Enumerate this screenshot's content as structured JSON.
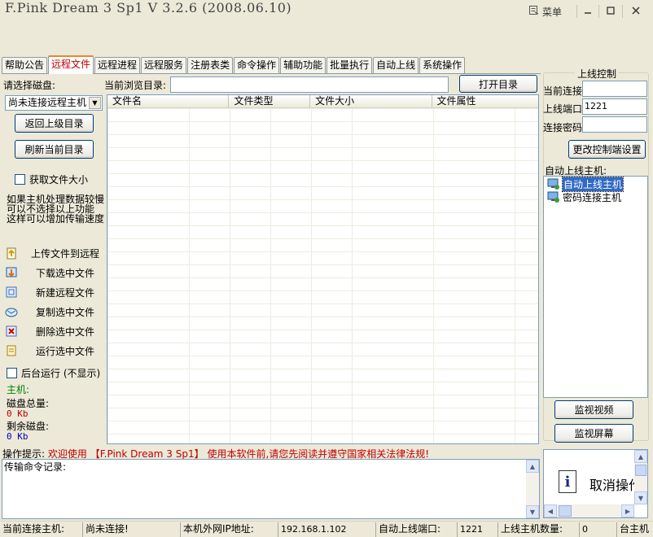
{
  "window": {
    "title": "F.Pink Dream 3 Sp1 V 3.2.6 (2008.06.10)",
    "menu_label": "菜单",
    "menu_icon": "list-icon"
  },
  "tabs": [
    {
      "label": "帮助公告"
    },
    {
      "label": "远程文件",
      "active": true
    },
    {
      "label": "远程进程"
    },
    {
      "label": "远程服务"
    },
    {
      "label": "注册表类"
    },
    {
      "label": "命令操作"
    },
    {
      "label": "辅助功能"
    },
    {
      "label": "批量执行"
    },
    {
      "label": "自动上线"
    },
    {
      "label": "系统操作"
    }
  ],
  "left": {
    "disk_label": "请选择磁盘:",
    "disk_value": "尚未连接远程主机",
    "up_button": "返回上级目录",
    "refresh_button": "刷新当前目录",
    "get_size_label": "获取文件大小",
    "hint": [
      "如果主机处理数据较慢",
      "可以不选择以上功能",
      "这样可以增加传输速度"
    ],
    "actions": [
      {
        "label": "上传文件到远程",
        "icon": "upload-icon"
      },
      {
        "label": "下载选中文件",
        "icon": "download-icon"
      },
      {
        "label": "新建远程文件",
        "icon": "new-file-icon"
      },
      {
        "label": "复制选中文件",
        "icon": "copy-icon"
      },
      {
        "label": "删除选中文件",
        "icon": "delete-icon"
      },
      {
        "label": "运行选中文件",
        "icon": "run-icon"
      }
    ],
    "hidden_run_label": "后台运行 (不显示)",
    "host_label": "主机:",
    "disk_total_label": "磁盘总量:",
    "disk_total_value": "0 Kb",
    "disk_free_label": "剩余磁盘:",
    "disk_free_value": "0 Kb"
  },
  "browse": {
    "label": "当前浏览目录:",
    "value": "",
    "open_button": "打开目录"
  },
  "file_table": {
    "columns": [
      "文件名",
      "文件类型",
      "文件大小",
      "文件属性"
    ],
    "rows": []
  },
  "right": {
    "group_title": "上线控制",
    "current_conn_label": "当前连接",
    "current_conn_value": "",
    "port_label": "上线端口",
    "port_value": "1221",
    "password_label": "连接密码",
    "password_value": "",
    "change_button": "更改控制端设置",
    "auto_hosts_label": "自动上线主机:",
    "tree_items": [
      "自动上线主机",
      "密码连接主机"
    ],
    "video_button": "监视视频",
    "screen_button": "监视屏幕"
  },
  "log": {
    "prompt_label": "操作提示:",
    "prompt_text": "欢迎使用 【F.Pink Dream 3 Sp1】 使用本软件前,请您先阅读并遵守国家相关法律法规!",
    "record_label": "传输命令记录:"
  },
  "notice": {
    "text": "取消操作"
  },
  "status": {
    "current_host_label": "当前连接主机:",
    "current_host_value": "尚未连接!",
    "ip_label": "本机外网IP地址:",
    "ip_value": "192.168.1.102",
    "port_label": "自动上线端口:",
    "port_value": "1221",
    "count_label": "上线主机数量:",
    "count_value": "0",
    "tail_label": "台主机"
  }
}
